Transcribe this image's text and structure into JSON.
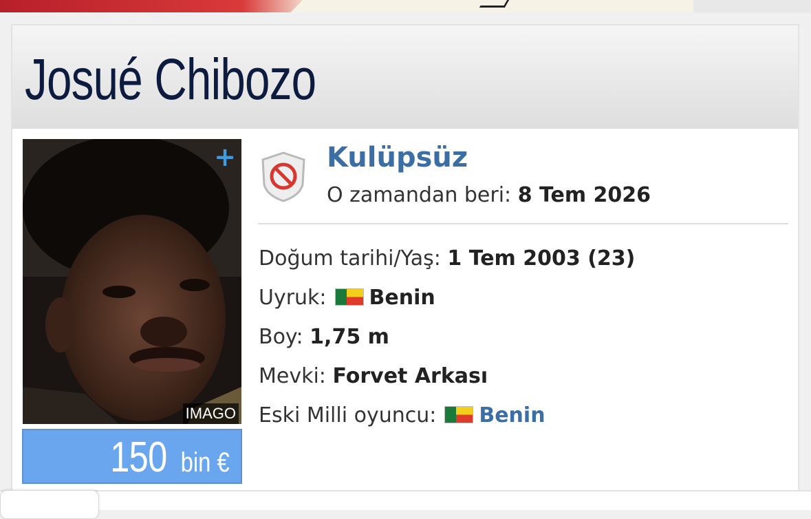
{
  "player": {
    "first_name": "Josué",
    "last_name": "Chibozo",
    "photo_credit": "IMAGO",
    "market_value": {
      "amount": "150",
      "unit": "bin €"
    }
  },
  "club": {
    "name": "Kulüpsüz",
    "since_label": "O zamandan beri:",
    "since_value": "8 Tem 2026",
    "crest_icon": "no-club-crest-icon"
  },
  "details": {
    "birth_label": "Doğum tarihi/Yaş:",
    "birth_value": "1 Tem 2003 (23)",
    "nationality_label": "Uyruk:",
    "nationality_value": "Benin",
    "height_label": "Boy:",
    "height_value": "1,75 m",
    "position_label": "Mevki:",
    "position_value": "Forvet Arkası",
    "former_intl_label": "Eski Milli oyuncu:",
    "former_intl_value": "Benin"
  },
  "colors": {
    "link": "#3a6ea5",
    "market_value_bg": "#6aa6ee",
    "name": "#0d1b3e",
    "plus": "#3f9be0"
  }
}
